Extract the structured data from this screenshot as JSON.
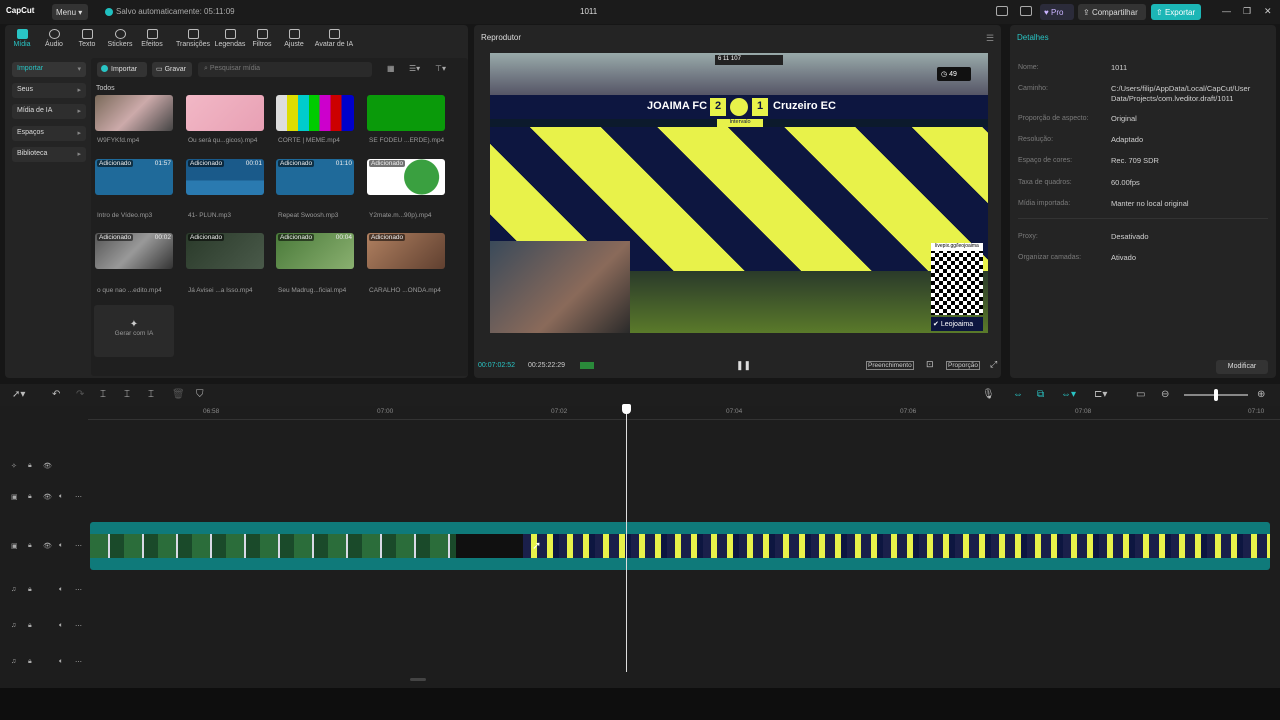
{
  "titlebar": {
    "logo": "CapCut",
    "menu_label": "Menu",
    "autosave": "Salvo automaticamente: 05:11:09",
    "project_title": "1011",
    "pro_label": "Pro",
    "share_label": "Compartilhar",
    "export_label": "Exportar"
  },
  "toolbar": {
    "tabs": [
      {
        "label": "Mídia"
      },
      {
        "label": "Áudio"
      },
      {
        "label": "Texto"
      },
      {
        "label": "Stickers"
      },
      {
        "label": "Efeitos"
      },
      {
        "label": "Transições"
      },
      {
        "label": "Legendas"
      },
      {
        "label": "Filtros"
      },
      {
        "label": "Ajuste"
      },
      {
        "label": "Avatar de IA"
      }
    ]
  },
  "sidebar": {
    "items": [
      {
        "label": "Importar"
      },
      {
        "label": "Seus"
      },
      {
        "label": "Mídia de IA"
      },
      {
        "label": "Espaços"
      },
      {
        "label": "Biblioteca"
      }
    ]
  },
  "media": {
    "import_label": "Importar",
    "record_label": "Gravar",
    "search_placeholder": "Pesquisar mídia",
    "section_label": "Todos",
    "added_label": "Adicionado",
    "items": [
      {
        "name": "W9FYKfd.mp4",
        "duration": ""
      },
      {
        "name": "Ou será qu...gicos).mp4",
        "duration": ""
      },
      {
        "name": "CORTE  |  MEME.mp4",
        "duration": ""
      },
      {
        "name": "SE FODEU ...ERDE).mp4",
        "duration": ""
      },
      {
        "name": "Intro de Vídeo.mp3",
        "duration": "01:57"
      },
      {
        "name": "41- PLUN.mp3",
        "duration": "00:01"
      },
      {
        "name": "Repeat Swoosh.mp3",
        "duration": "01:10"
      },
      {
        "name": "Y2mate.m...90p).mp4",
        "duration": ""
      },
      {
        "name": "o que nao ...edito.mp4",
        "duration": "00:02"
      },
      {
        "name": "Já Avisei ...a Isso.mp4",
        "duration": ""
      },
      {
        "name": "Seu Madrug...ficial.mp4",
        "duration": "00:04"
      },
      {
        "name": "CARALHO ...ONDA.mp4",
        "duration": ""
      }
    ],
    "generate_label": "Gerar com IA"
  },
  "player": {
    "title": "Reprodutor",
    "scoreboard": {
      "home": "JOAIMA FC",
      "home_score": "2",
      "away_score": "1",
      "away": "Cruzeiro EC",
      "status": "Intervalo",
      "timer": "49",
      "stats": "6   11   107"
    },
    "qr_caption": "livepix.gg/leojoaima",
    "handle": "Leojoaima",
    "current_time": "00:07:02:52",
    "total_time": "00:25:22:29",
    "fill_label": "Preenchimento",
    "ratio_label": "Proporção"
  },
  "details": {
    "title": "Detalhes",
    "rows": [
      {
        "key": "Nome:",
        "value": "1011"
      },
      {
        "key": "Caminho:",
        "value": "C:/Users/filip/AppData/Local/CapCut/User Data/Projects/com.lveditor.draft/1011"
      },
      {
        "key": "Proporção de aspecto:",
        "value": "Original"
      },
      {
        "key": "Resolução:",
        "value": "Adaptado"
      },
      {
        "key": "Espaço de cores:",
        "value": "Rec. 709 SDR"
      },
      {
        "key": "Taxa de quadros:",
        "value": "60.00fps"
      },
      {
        "key": "Mídia importada:",
        "value": "Manter no local original"
      },
      {
        "key": "Proxy:",
        "value": "Desativado"
      },
      {
        "key": "Organizar camadas:",
        "value": "Ativado"
      }
    ],
    "modify_label": "Modificar"
  },
  "timeline": {
    "ruler": [
      "06:58",
      "07:00",
      "07:02",
      "07:04",
      "07:06",
      "07:08",
      "07:10"
    ]
  },
  "colors": {
    "accent": "#29c4c4",
    "scoreboard_bg": "#0d1640",
    "scoreboard_yellow": "#e8f24a"
  }
}
